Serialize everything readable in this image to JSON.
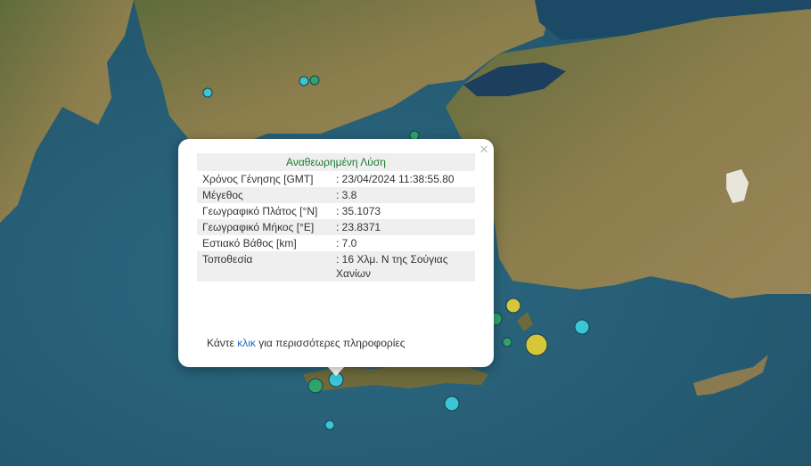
{
  "popup": {
    "title": "Αναθεωρημένη Λύση",
    "close_glyph": "×",
    "rows": [
      {
        "label": "Χρόνος Γένησης [GMT]",
        "value": ": 23/04/2024 11:38:55.80"
      },
      {
        "label": "Μέγεθος",
        "value": ": 3.8"
      },
      {
        "label": "Γεωγραφικό Πλάτος [°N]",
        "value": ": 35.1073"
      },
      {
        "label": "Γεωγραφικό Μήκος [°E]",
        "value": ": 23.8371"
      },
      {
        "label": "Εστιακό Βάθος [km]",
        "value": ": 7.0"
      },
      {
        "label": "Τοποθεσία",
        "value": ": 16 Χλμ. Ν της Σούγιας Χανίων"
      }
    ],
    "more_prefix": "Κάντε ",
    "more_link": "κλικ",
    "more_suffix": " για περισσότερες πληροφορίες"
  },
  "map": {
    "colors": {
      "sea": "#2e6f86",
      "land": "#8a7a48",
      "cyan_marker": "#39c6d6",
      "green_marker": "#2fa46a",
      "yellow_marker": "#d8c63a"
    }
  }
}
